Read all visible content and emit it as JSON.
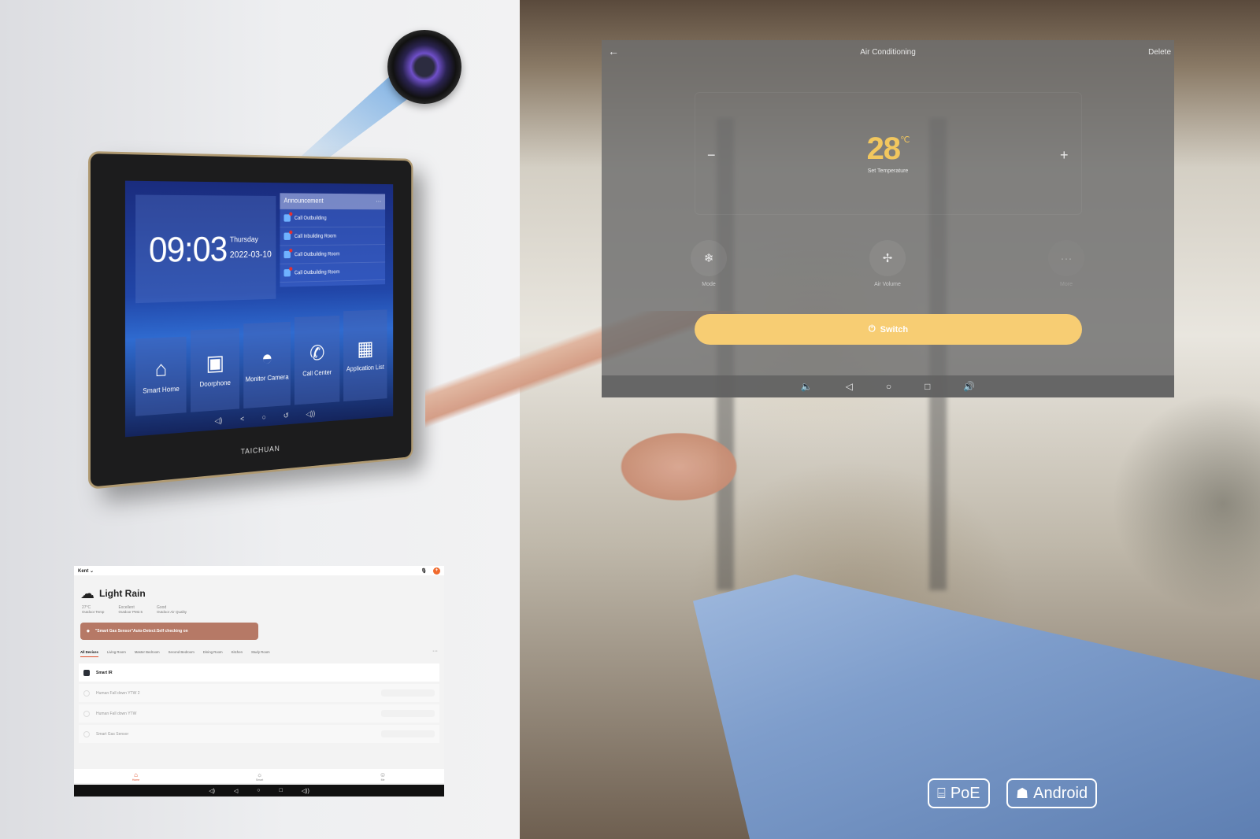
{
  "wall_panel": {
    "time": "09:03",
    "day": "Thursday",
    "date": "2022-03-10",
    "announcement_title": "Announcement",
    "announcements": [
      {
        "text": "Call Outbuilding"
      },
      {
        "text": "Call Inbuilding Room"
      },
      {
        "text": "Call Outbuilding Room"
      },
      {
        "text": "Call Outbuilding Room"
      }
    ],
    "tiles": [
      {
        "icon": "smart-home-icon",
        "glyph": "⌂",
        "label": "Smart Home"
      },
      {
        "icon": "doorphone-icon",
        "glyph": "▣",
        "label": "Doorphone"
      },
      {
        "icon": "camera-icon",
        "glyph": "◓",
        "label": "Monitor Camera"
      },
      {
        "icon": "phone-icon",
        "glyph": "✆",
        "label": "Call Center"
      },
      {
        "icon": "apps-icon",
        "glyph": "▦",
        "label": "Application List"
      }
    ],
    "nav": [
      "◁)",
      "<",
      "○",
      "↺",
      "◁))"
    ],
    "brand": "TAICHUAN"
  },
  "ac_screen": {
    "back_glyph": "←",
    "title": "Air Conditioning",
    "delete_label": "Delete",
    "minus": "−",
    "plus": "+",
    "temperature": "28",
    "unit": "℃",
    "temperature_label": "Set Temperature",
    "controls": [
      {
        "icon": "snowflake-icon",
        "glyph": "❄",
        "label": "Mode"
      },
      {
        "icon": "fan-icon",
        "glyph": "✢",
        "label": "Air Volume"
      },
      {
        "icon": "more-icon",
        "glyph": "···",
        "label": "More"
      }
    ],
    "switch_label": "Switch",
    "power_glyph": "⏻",
    "nav": [
      "🔈",
      "◁",
      "○",
      "□",
      "🔊"
    ]
  },
  "app": {
    "home_name": "Kent ⌄",
    "notification_count": "+",
    "weather": {
      "title": "Light Rain",
      "glyph": "☁"
    },
    "stats": [
      {
        "value": "27°C",
        "label": "Outdoor Temp"
      },
      {
        "value": "Excellent",
        "label": "Outdoor PM2.5"
      },
      {
        "value": "Good",
        "label": "Outdoor Air Quality"
      }
    ],
    "alert": "\"Smart Gas Sensor\"Auto-Detect:Self checking on",
    "tabs": [
      "All Devices",
      "Living Room",
      "Master Bedroom",
      "Second Bedroom",
      "Dining Room",
      "Kitchen",
      "Study Room"
    ],
    "more": "···",
    "devices": [
      {
        "name": "Smart IR",
        "active": true
      },
      {
        "name": "Human Fall down YTW 2",
        "active": false
      },
      {
        "name": "Human Fall down YTW",
        "active": false
      },
      {
        "name": "Smart Gas Sensor",
        "active": false
      }
    ],
    "bottom_tabs": [
      {
        "glyph": "⌂",
        "label": "Home"
      },
      {
        "glyph": "☼",
        "label": "Smart"
      },
      {
        "glyph": "☺",
        "label": "Me"
      }
    ],
    "sysnav": [
      "◁)",
      "◁",
      "○",
      "□",
      "◁))"
    ]
  },
  "badges": [
    {
      "icon": "ethernet-icon",
      "glyph": "⌸",
      "label": "PoE"
    },
    {
      "icon": "android-icon",
      "glyph": "☗",
      "label": "Android"
    }
  ]
}
